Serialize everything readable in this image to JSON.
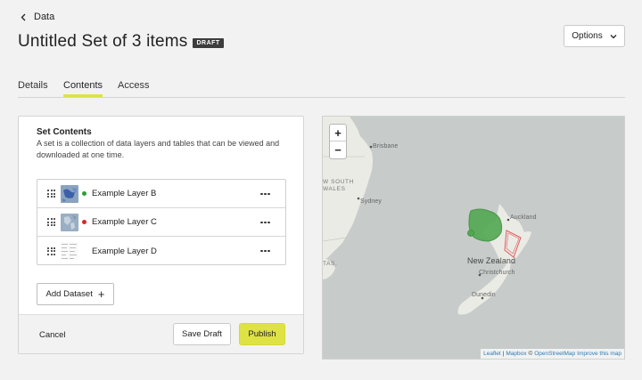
{
  "header": {
    "back_label": "Data",
    "title": "Untitled Set of 3 items",
    "badge": "DRAFT",
    "options_label": "Options"
  },
  "tabs": [
    {
      "label": "Details",
      "active": false
    },
    {
      "label": "Contents",
      "active": true
    },
    {
      "label": "Access",
      "active": false
    }
  ],
  "contents": {
    "heading": "Set Contents",
    "description": "A set is a collection of data layers and tables that can be viewed and downloaded at one time.",
    "layers": [
      {
        "name": "Example Layer B",
        "status_color": "#2e9a3a"
      },
      {
        "name": "Example Layer C",
        "status_color": "#d62828"
      },
      {
        "name": "Example Layer D",
        "status_color": ""
      }
    ],
    "add_dataset_label": "Add Dataset",
    "add_icon": "+"
  },
  "footer": {
    "cancel_label": "Cancel",
    "save_draft_label": "Save Draft",
    "publish_label": "Publish"
  },
  "map": {
    "zoom_in": "+",
    "zoom_out": "−",
    "labels": {
      "brisbane": "Brisbane",
      "nsw_line1": "W SOUTH",
      "nsw_line2": "WALES",
      "sydney": "Sydney",
      "tas": "TAS.",
      "auckland": "Auckland",
      "new_zealand": "New Zealand",
      "christchurch": "Christchurch",
      "dunedin": "Dunedin"
    },
    "attribution": {
      "leaflet": "Leaflet",
      "separator": "|",
      "copyright": "©",
      "mapbox": "Mapbox",
      "osm": "OpenStreetMap",
      "improve": "Improve this map"
    }
  },
  "colors": {
    "accent": "#dfe244",
    "badge_bg": "#3d3d3d",
    "map_water": "#c7cccb",
    "map_land": "#ebebe6",
    "layer_green": "#52a852",
    "layer_red": "#e05a5a"
  }
}
